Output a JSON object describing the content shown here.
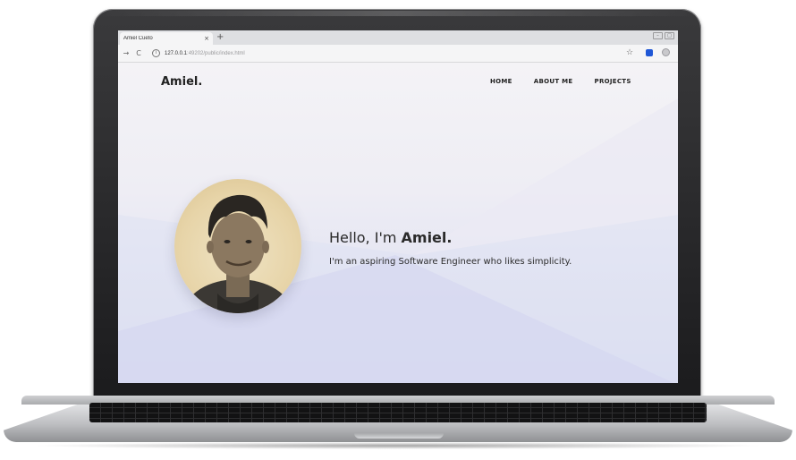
{
  "browser": {
    "tab_title": "Amiel Cueto",
    "tab_close": "×",
    "new_tab": "+",
    "url_host": "127.0.0.1",
    "url_path": ":49202/public/index.html",
    "back": "→",
    "reload": "C",
    "star": "☆",
    "window_controls": [
      "–",
      "□"
    ]
  },
  "site": {
    "brand": "Amiel.",
    "nav": [
      "HOME",
      "ABOUT ME",
      "PROJECTS"
    ],
    "hero": {
      "greeting": "Hello, I'm ",
      "name": "Amiel.",
      "tagline": "I'm an aspiring Software Engineer who likes simplicity."
    }
  },
  "colors": {
    "page_top": "#f4f3f6",
    "page_bottom": "#d7daf1",
    "text": "#222222",
    "extension_icon": "#1f57d6"
  },
  "icons": [
    "back-arrow-icon",
    "reload-icon",
    "info-icon",
    "star-icon",
    "extension-icon",
    "profile-icon",
    "close-icon",
    "new-tab-icon"
  ]
}
